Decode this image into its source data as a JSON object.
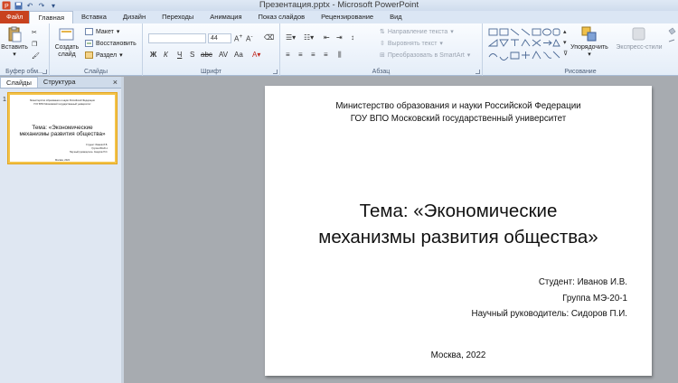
{
  "window": {
    "title": "Презентация.pptx - Microsoft PowerPoint"
  },
  "qat": {
    "icons": [
      "powerpoint-icon",
      "save-icon",
      "undo-icon",
      "redo-icon",
      "customize-icon"
    ]
  },
  "tabs": [
    {
      "label": "Файл"
    },
    {
      "label": "Главная"
    },
    {
      "label": "Вставка"
    },
    {
      "label": "Дизайн"
    },
    {
      "label": "Переходы"
    },
    {
      "label": "Анимация"
    },
    {
      "label": "Показ слайдов"
    },
    {
      "label": "Рецензирование"
    },
    {
      "label": "Вид"
    }
  ],
  "ribbon": {
    "clipboard": {
      "label": "Буфер обм...",
      "paste": "Вставить"
    },
    "slides": {
      "label": "Слайды",
      "new_slide_1": "Создать",
      "new_slide_2": "слайд",
      "layout": "Макет",
      "reset": "Восстановить",
      "section": "Раздел"
    },
    "font": {
      "label": "Шрифт",
      "font_size": "44"
    },
    "paragraph": {
      "label": "Абзац",
      "text_direction": "Направление текста",
      "align_text": "Выровнять текст",
      "smartart": "Преобразовать в SmartArt"
    },
    "drawing": {
      "label": "Рисование",
      "arrange": "Упорядочить",
      "quick_styles": "Экспресс-стили"
    }
  },
  "pane": {
    "tab_slides": "Слайды",
    "tab_outline": "Структура",
    "close": "×",
    "slide_number": "1"
  },
  "slide": {
    "header_line1": "Министерство образования и науки Российской Федерации",
    "header_line2": "ГОУ ВПО Московский государственный университет",
    "title_line1": "Тема: «Экономические",
    "title_line2": "механизмы развития общества»",
    "student": "Студент: Иванов И.В.",
    "group": "Группа МЭ-20-1",
    "supervisor": "Научный руководитель: Сидоров П.И.",
    "city_year": "Москва, 2022"
  }
}
